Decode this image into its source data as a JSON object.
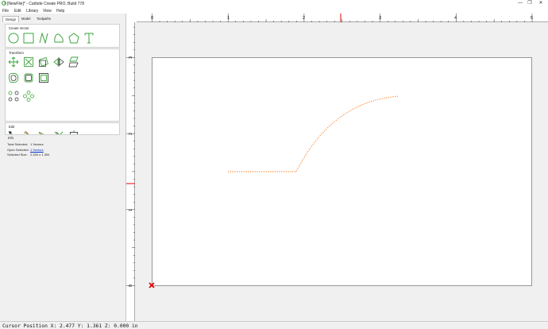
{
  "window": {
    "title": "[NewFile]* - Carbide Create PRO, Build 778",
    "minimize_glyph": "—",
    "restore_glyph": "❐",
    "close_glyph": "✕"
  },
  "menu": [
    "File",
    "Edit",
    "Library",
    "View",
    "Help"
  ],
  "tabs": [
    "Design",
    "Model",
    "Toolpaths"
  ],
  "create_vector": {
    "title": "Create Vector",
    "tools": [
      "circle-icon",
      "rectangle-icon",
      "polyline-icon",
      "curve-icon",
      "polygon-icon",
      "text-icon"
    ]
  },
  "transform": {
    "title": "Transform",
    "tools_row1": [
      "move-icon",
      "scale-icon",
      "rotate-icon",
      "mirror-icon",
      "skew-icon"
    ],
    "tools_row2": [
      "offset-icon",
      "boolean-icon",
      "align-icon"
    ],
    "tools_row3": [
      "array-circular-icon",
      "array-grid-icon"
    ]
  },
  "edit": {
    "title": "Edit",
    "tools": [
      "node-edit-icon",
      "join-icon",
      "fillet-icon",
      "trim-icon",
      "boundary-icon"
    ]
  },
  "info": {
    "title": "Info",
    "rows": [
      {
        "label": "Total Selected:",
        "value": "1 Vectors"
      },
      {
        "label": "Open Selected:",
        "value": "1 Vectors"
      },
      {
        "label": "Selected Size:",
        "value": "2.250 x 1.300"
      }
    ]
  },
  "ruler": {
    "x_labels": [
      "0",
      "1",
      "2",
      "3",
      "4",
      "5"
    ],
    "y_labels": [
      "0",
      "1",
      "2",
      "3"
    ]
  },
  "status": {
    "cursor": "Cursor Position X: 2.477 Y: 1.361 Z: 0.000 in"
  },
  "colors": {
    "accent": "#ff0000",
    "tool_green": "#3aa63a",
    "path_orange": "#ff6a00"
  }
}
